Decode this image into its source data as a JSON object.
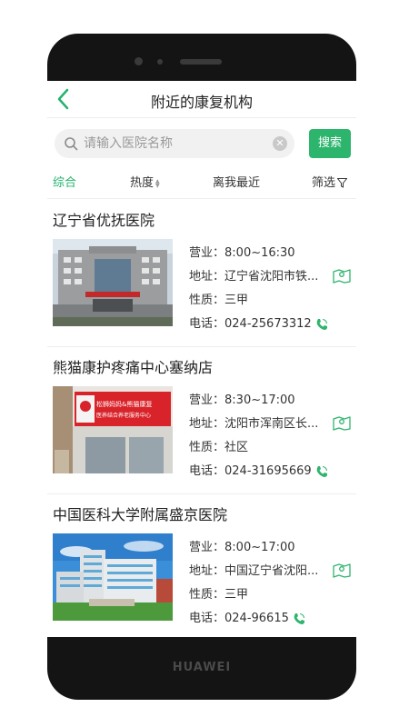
{
  "header": {
    "title": "附近的康复机构"
  },
  "search": {
    "placeholder": "请输入医院名称",
    "button_label": "搜索"
  },
  "tabs": [
    {
      "label": "综合",
      "active": true
    },
    {
      "label": "热度"
    },
    {
      "label": "离我最近"
    },
    {
      "label": "筛选"
    }
  ],
  "facilities": [
    {
      "name": "辽宁省优抚医院",
      "hours_label": "营业：",
      "hours": "8:00~16:30",
      "address_label": "地址：",
      "address": "辽宁省沈阳市铁...",
      "type_label": "性质：",
      "type": "三甲",
      "phone_label": "电话：",
      "phone": "024-25673312"
    },
    {
      "name": "熊猫康护疼痛中心塞纳店",
      "hours_label": "营业：",
      "hours": "8:30~17:00",
      "address_label": "地址：",
      "address": "沈阳市浑南区长...",
      "type_label": "性质：",
      "type": "社区",
      "phone_label": "电话：",
      "phone": "024-31695669",
      "sign_text": "松狮妈妈&熊猫康复",
      "sign_subtext": "医养结合养老服务中心"
    },
    {
      "name": "中国医科大学附属盛京医院",
      "hours_label": "营业：",
      "hours": "8:00~17:00",
      "address_label": "地址：",
      "address": "中国辽宁省沈阳...",
      "type_label": "性质：",
      "type": "三甲",
      "phone_label": "电话：",
      "phone": "024-96615"
    }
  ],
  "device": {
    "brand": "HUAWEI"
  },
  "colors": {
    "accent": "#23b26d",
    "button": "#2eb56d",
    "divider": "#eeeeee"
  }
}
